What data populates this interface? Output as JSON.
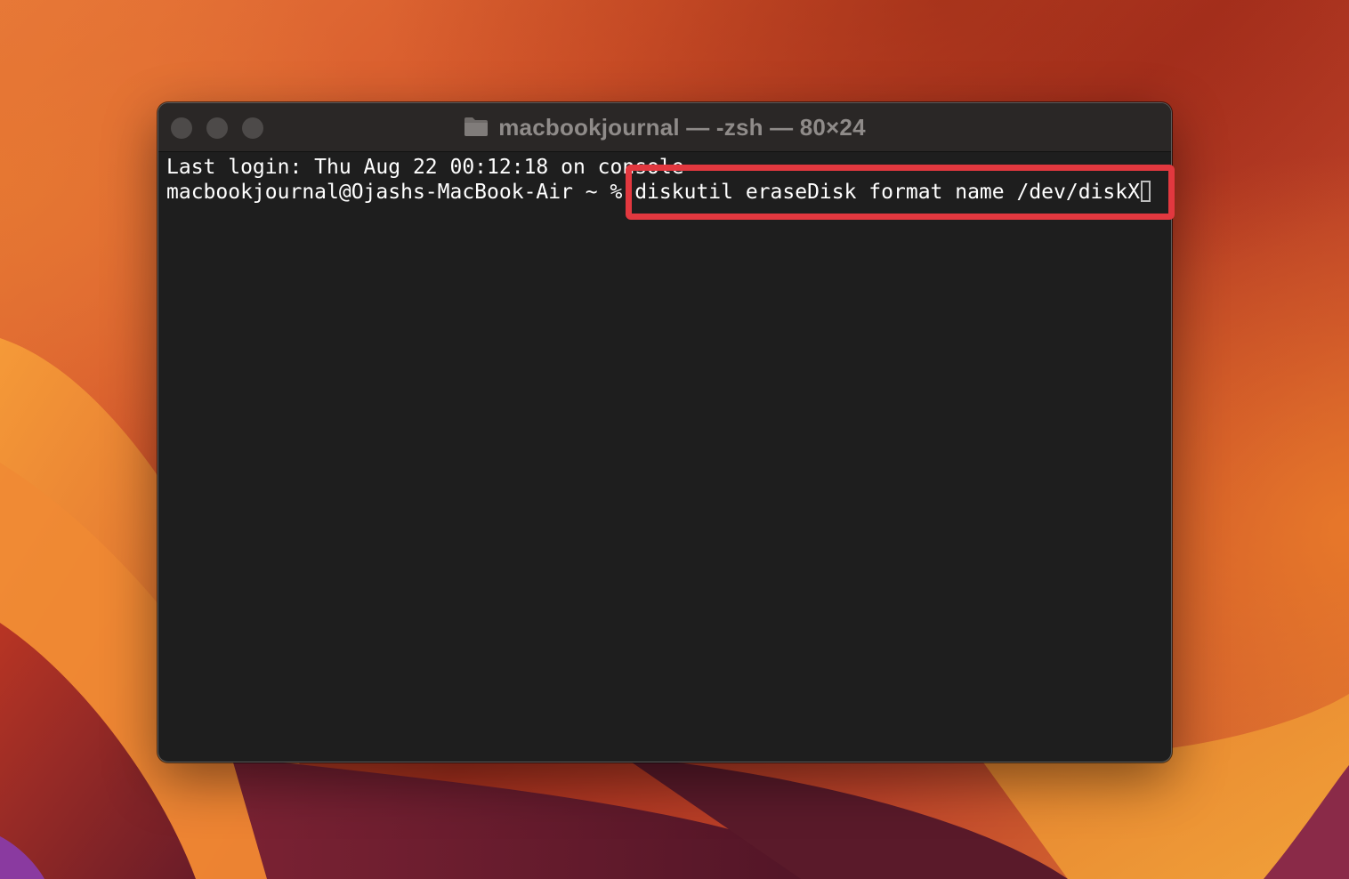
{
  "window": {
    "title": "macbookjournal — -zsh — 80×24",
    "controls": [
      "close",
      "minimize",
      "maximize"
    ],
    "title_icon": "folder-icon"
  },
  "terminal": {
    "last_login_line": "Last login: Thu Aug 22 00:12:18 on console",
    "prompt": "macbookjournal@Ojashs-MacBook-Air ~ % ",
    "command": "diskutil eraseDisk format name /dev/diskX"
  },
  "colors": {
    "highlight": "#e2383f",
    "terminal_background": "#1e1e1e",
    "titlebar_background": "#2a2726",
    "text": "#ffffff"
  }
}
